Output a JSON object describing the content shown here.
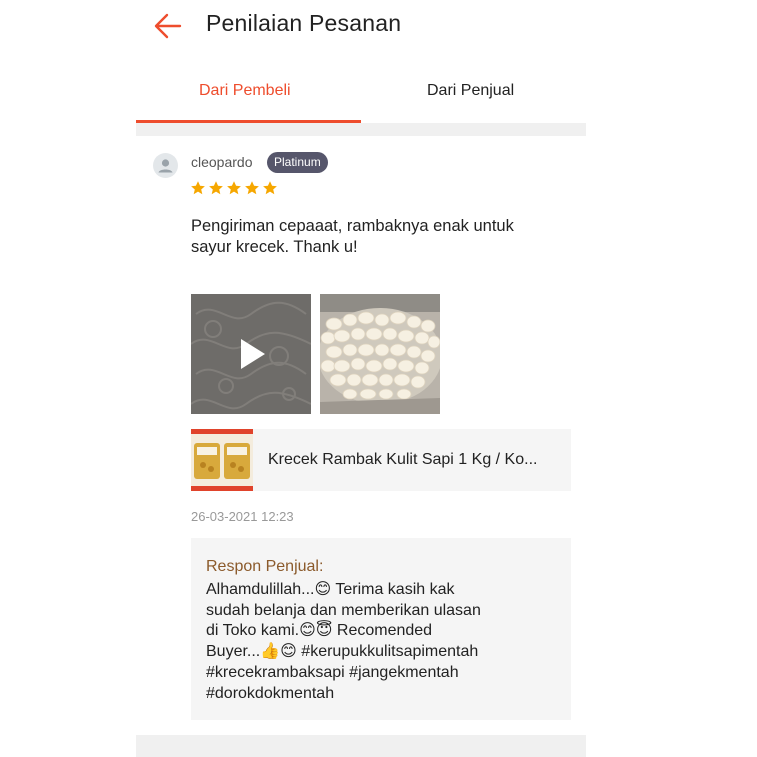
{
  "header": {
    "title": "Penilaian Pesanan",
    "back_icon": "arrow-left-icon",
    "accent_color": "#ee4d2d"
  },
  "tabs": [
    {
      "label": "Dari Pembeli",
      "active": true
    },
    {
      "label": "Dari Penjual",
      "active": false
    }
  ],
  "review": {
    "user": {
      "name": "cleopardo",
      "badge": "Platinum",
      "avatar_icon": "user-icon"
    },
    "rating": 5,
    "text": "Pengiriman cepaaat, rambaknya enak untuk sayur krecek. Thank u!",
    "media": [
      {
        "type": "video",
        "icon": "play-icon"
      },
      {
        "type": "photo"
      }
    ],
    "product": {
      "name": "Krecek Rambak Kulit Sapi 1 Kg / Ko..."
    },
    "timestamp": "26-03-2021 12:23",
    "seller_response": {
      "title": "Respon Penjual:",
      "text": "Alhamdulillah...😊 Terima kasih kak\nsudah belanja dan memberikan ulasan\ndi Toko kami.😊😇 Recomended\nBuyer...👍😊 #kerupukkulitsapimentah\n#krecekrambaksapi #jangekmentah\n#dorokdokmentah"
    }
  }
}
